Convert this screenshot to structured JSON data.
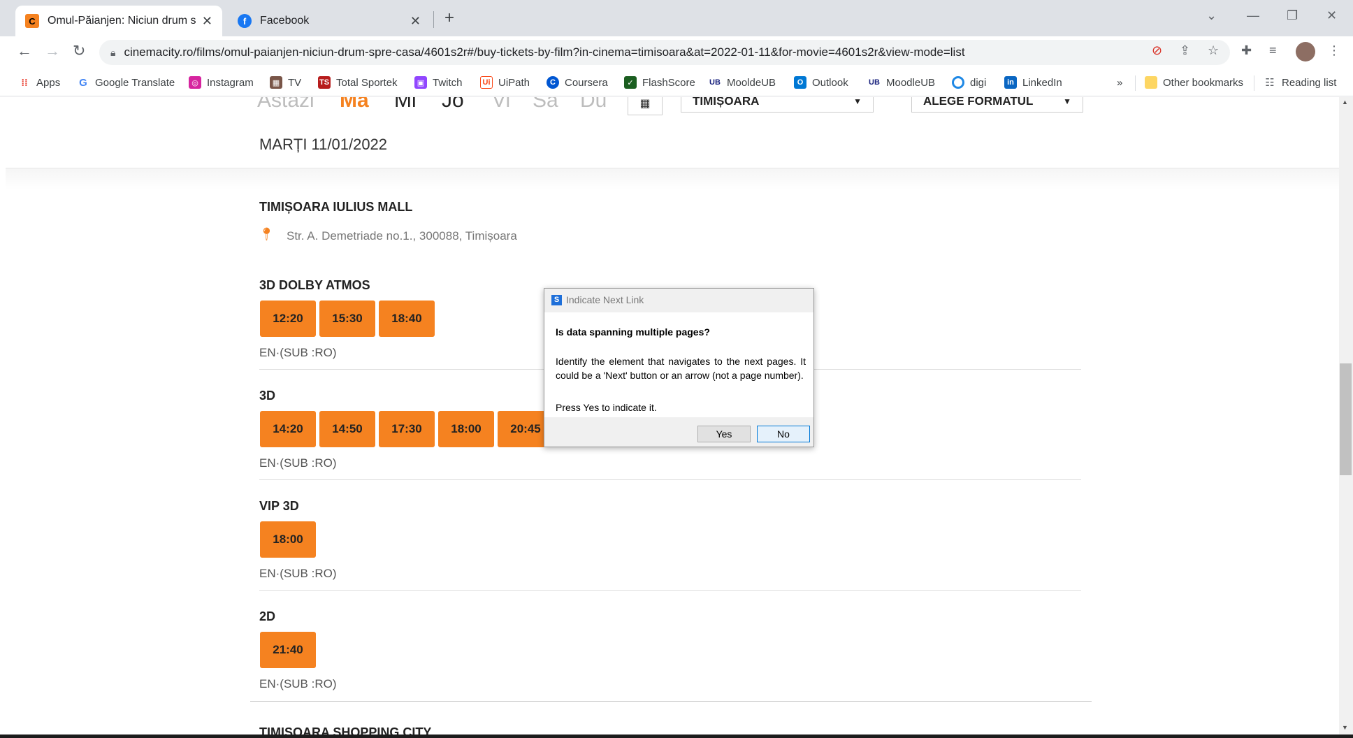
{
  "browser": {
    "tabs": [
      {
        "title": "Omul-Păianjen: Niciun drum spre",
        "favicon": "C"
      },
      {
        "title": "Facebook",
        "favicon": "f"
      }
    ],
    "new_tab": "+",
    "url": "cinemacity.ro/films/omul-paianjen-niciun-drum-spre-casa/4601s2r#/buy-tickets-by-film?in-cinema=timisoara&at=2022-01-11&for-movie=4601s2r&view-mode=list",
    "bookmarks": [
      {
        "label": "Apps",
        "icon": "apps-grid-icon"
      },
      {
        "label": "Google Translate",
        "icon": "google-icon"
      },
      {
        "label": "Instagram",
        "icon": "instagram-icon"
      },
      {
        "label": "TV",
        "icon": "tv-icon"
      },
      {
        "label": "Total Sportek",
        "icon": "ts-icon"
      },
      {
        "label": "Twitch",
        "icon": "twitch-icon"
      },
      {
        "label": "UiPath",
        "icon": "uipath-icon"
      },
      {
        "label": "Coursera",
        "icon": "coursera-icon"
      },
      {
        "label": "FlashScore",
        "icon": "flashscore-icon"
      },
      {
        "label": "MooldeUB",
        "icon": "ub-icon"
      },
      {
        "label": "Outlook",
        "icon": "outlook-icon"
      },
      {
        "label": "MoodleUB",
        "icon": "ub-icon"
      },
      {
        "label": "digi",
        "icon": "digi-icon"
      },
      {
        "label": "LinkedIn",
        "icon": "linkedin-icon"
      }
    ],
    "more_bookmarks": "»",
    "other_bookmarks": "Other bookmarks",
    "reading_list": "Reading list"
  },
  "page": {
    "days": [
      "Astazi",
      "Ma",
      "Mi",
      "Jo",
      "Vi",
      "Sa",
      "Du"
    ],
    "selected_day": "Ma",
    "city_select": "TIMIȘOARA",
    "format_select": "ALEGE FORMATUL",
    "date_heading": "MARȚI 11/01/2022",
    "cinema_name": "TIMIȘOARA IULIUS MALL",
    "cinema_address": "Str. A. Demetriade no.1., 300088, Timișoara",
    "sections": [
      {
        "format": "3D  DOLBY ATMOS",
        "times": [
          "12:20",
          "15:30",
          "18:40"
        ],
        "language": "EN·(SUB :RO)"
      },
      {
        "format": "3D",
        "times": [
          "14:20",
          "14:50",
          "17:30",
          "18:00",
          "20:45"
        ],
        "language": "EN·(SUB :RO)"
      },
      {
        "format": "VIP  3D",
        "times": [
          "18:00"
        ],
        "language": "EN·(SUB :RO)"
      },
      {
        "format": "2D",
        "times": [
          "21:40"
        ],
        "language": "EN·(SUB :RO)"
      }
    ],
    "next_cinema": "TIMIȘOARA SHOPPING CITY",
    "accent_color": "#f58220"
  },
  "dialog": {
    "title": "Indicate Next Link",
    "question": "Is data spanning multiple pages?",
    "text": "Identify the element that navigates to the next pages. It could be a 'Next' button or an arrow (not a page number).",
    "press": "Press Yes to indicate it.",
    "yes": "Yes",
    "no": "No"
  }
}
